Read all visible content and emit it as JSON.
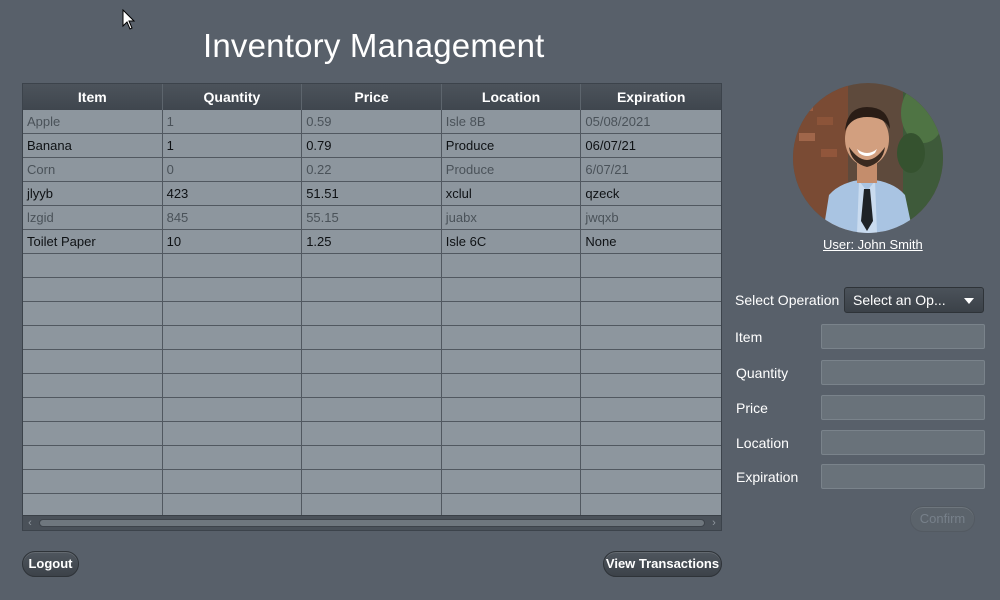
{
  "header": {
    "title": "Inventory Management"
  },
  "table": {
    "columns": [
      "Item",
      "Quantity",
      "Price",
      "Location",
      "Expiration"
    ],
    "rows": [
      [
        "Apple",
        "1",
        "0.59",
        "Isle 8B",
        "05/08/2021"
      ],
      [
        "Banana",
        "1",
        "0.79",
        "Produce",
        "06/07/21"
      ],
      [
        "Corn",
        "0",
        "0.22",
        "Produce",
        "6/07/21"
      ],
      [
        "jlyyb",
        "423",
        "51.51",
        "xclul",
        "qzeck"
      ],
      [
        "lzgid",
        "845",
        "55.15",
        "juabx",
        "jwqxb"
      ],
      [
        "Toilet Paper",
        "10",
        "1.25",
        "Isle 6C",
        "None"
      ],
      [
        "",
        "",
        "",
        "",
        ""
      ],
      [
        "",
        "",
        "",
        "",
        ""
      ],
      [
        "",
        "",
        "",
        "",
        ""
      ],
      [
        "",
        "",
        "",
        "",
        ""
      ],
      [
        "",
        "",
        "",
        "",
        ""
      ],
      [
        "",
        "",
        "",
        "",
        ""
      ],
      [
        "",
        "",
        "",
        "",
        ""
      ],
      [
        "",
        "",
        "",
        "",
        ""
      ],
      [
        "",
        "",
        "",
        "",
        ""
      ],
      [
        "",
        "",
        "",
        "",
        ""
      ],
      [
        "",
        "",
        "",
        "",
        ""
      ]
    ]
  },
  "footer": {
    "logout_label": "Logout",
    "view_transactions_label": "View Transactions"
  },
  "user": {
    "label": "User: John Smith"
  },
  "form": {
    "operation_label": "Select Operation",
    "operation_selected": "Select an Op...",
    "item_label": "Item",
    "quantity_label": "Quantity",
    "price_label": "Price",
    "location_label": "Location",
    "expiration_label": "Expiration",
    "confirm_label": "Confirm"
  },
  "colors": {
    "background": "#58606a",
    "table_cell": "#8d969e",
    "header": "#3f464e"
  },
  "icons": {
    "cursor": "mouse-pointer-icon",
    "dropdown": "caret-down-icon",
    "scroll_left": "chevron-left-icon",
    "scroll_right": "chevron-right-icon"
  }
}
